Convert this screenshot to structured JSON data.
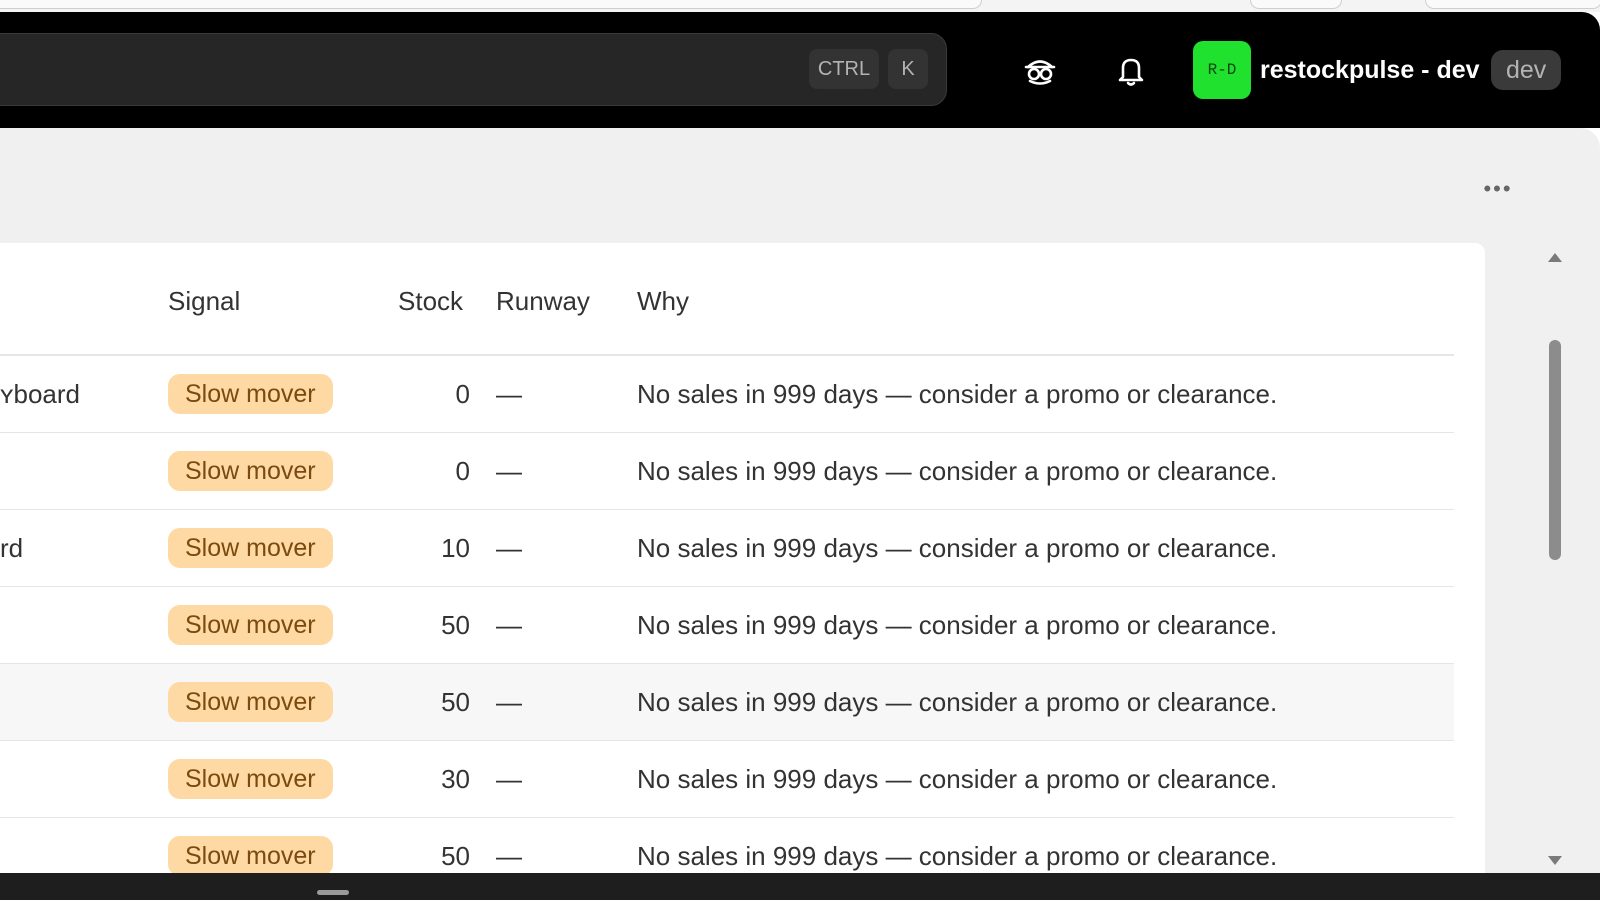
{
  "topbar": {
    "search": {
      "shortcut_ctrl": "CTRL",
      "shortcut_key": "K"
    },
    "icons": {
      "incognito": "incognito-icon",
      "notifications": "bell-icon"
    },
    "org": {
      "initials": "R-D",
      "name": "restockpulse - dev",
      "badge": "dev",
      "avatar_color": "#20e22e"
    }
  },
  "panel": {
    "more_label": "•••"
  },
  "table": {
    "columns": {
      "signal": "Signal",
      "stock": "Stock",
      "runway": "Runway",
      "why": "Why"
    },
    "rows": [
      {
        "product": "ʏboard",
        "signal": "Slow mover",
        "stock": "0",
        "runway": "—",
        "why": "No sales in 999 days — consider a promo or clearance."
      },
      {
        "product": "",
        "signal": "Slow mover",
        "stock": "0",
        "runway": "—",
        "why": "No sales in 999 days — consider a promo or clearance."
      },
      {
        "product": "rd",
        "signal": "Slow mover",
        "stock": "10",
        "runway": "—",
        "why": "No sales in 999 days — consider a promo or clearance."
      },
      {
        "product": "",
        "signal": "Slow mover",
        "stock": "50",
        "runway": "—",
        "why": "No sales in 999 days — consider a promo or clearance."
      },
      {
        "product": "",
        "signal": "Slow mover",
        "stock": "50",
        "runway": "—",
        "why": "No sales in 999 days — consider a promo or clearance."
      },
      {
        "product": "",
        "signal": "Slow mover",
        "stock": "30",
        "runway": "—",
        "why": "No sales in 999 days — consider a promo or clearance."
      },
      {
        "product": "",
        "signal": "Slow mover",
        "stock": "50",
        "runway": "—",
        "why": "No sales in 999 days — consider a promo or clearance."
      }
    ]
  },
  "colors": {
    "topbar": "#000000",
    "badge_bg": "#ffd9a3",
    "badge_text": "#7a4a0e",
    "panel_bg": "#f0f0f0"
  }
}
